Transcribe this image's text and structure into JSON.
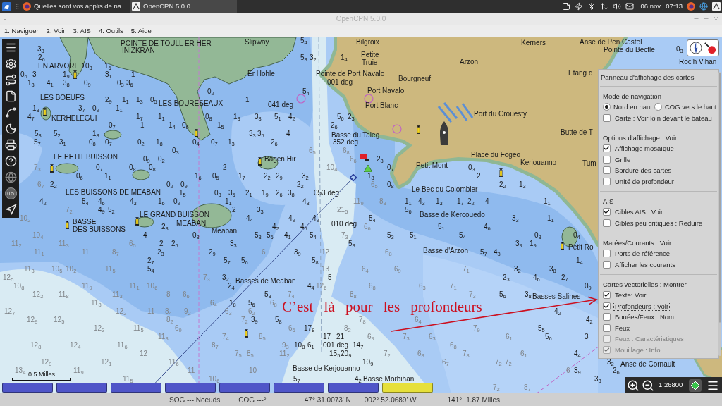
{
  "taskbar": {
    "windows": [
      {
        "title": "Quelles sont vos applis de na...",
        "selected": false
      },
      {
        "title": "OpenCPN 5.0.0",
        "selected": true
      }
    ],
    "clock": "06 nov., 07:13"
  },
  "window": {
    "title": "OpenCPN 5.0.0"
  },
  "menu": [
    "1: Naviguer",
    "2: Voir",
    "3: AIS",
    "4: Outils",
    "5: Aide"
  ],
  "toolbar": {
    "scale_button": "0.5"
  },
  "map": {
    "labels": [
      "POINTE DE TOULL ER HER",
      "INIZKRAN",
      "Slipway",
      "EN ARVORED",
      "Er Hohle",
      "LES BOEUFS",
      "KERHELEGUI",
      "LES BOURESEAUX",
      "041 deg",
      "LE PETIT BUISSON",
      "Bagen Hir",
      "LES BUISSONS DE MEABAN",
      "BASSE",
      "DES BUISSONS",
      "LE GRAND BUISSON",
      "MEABAN",
      "Meaban",
      "Basses de Meaban",
      "Bilgroix",
      "Petite",
      "Truie",
      "Pointe de Port Navalo",
      "001 deg",
      "Bourgneuf",
      "Arzon",
      "Kerners",
      "Anse de Pen Castel",
      "Pointe du Becfle",
      "Roc'h Vihan",
      "Etang d",
      "Port Navalo",
      "Port Blanc",
      "Port du Crouesty",
      "Butte de T",
      "Basse du Taleg",
      "352 deg",
      "Place du Fogeo",
      "Petit Mont",
      "Kerjouanno",
      "Tum",
      "Le Bec du Colombier",
      "053 deg",
      "Basse de Kercouedo",
      "010 deg",
      "Petit Ro",
      "Basse d'Arzon",
      "Basses Salines",
      "001 deg",
      "Basse de Kerjouanno",
      "Basse Morbihan",
      "Anse de Cornault"
    ],
    "soundings": [
      "5$_{4}$",
      "3$_{8}$",
      "0$_{3}$",
      "2$_{6}$",
      "5$_{3}$",
      "3$_{2}$",
      "1$_{4}$",
      "0$_{3}$",
      "1$_{6}$",
      "0$_{6}$",
      "3",
      "1$_{9}$",
      "3$_{1}$",
      "1",
      "1$_{3}$",
      "4$_{1}$",
      "3$_{8}$",
      "0$_{9}$",
      "0$_{3}$",
      "3$_{6}$",
      "0$_{2}$",
      "5$_{4}$",
      "2$_{9}$",
      "1$_{1}$",
      "1$_{3}$",
      "0$_{5}$",
      "1",
      "1$_{8}$",
      "3$_{7}$",
      "0$_{9}$",
      "1$_{1}$",
      "4$_{7}$",
      "1$_{7}$",
      "1$_{1}$",
      "0$_{8}$",
      "1$_{3}$",
      "3$_{8}$",
      "5$_{1}$",
      "4$_{2}$",
      "5$_{6}$",
      "2$_{3}$",
      "0$_{7}$",
      "1",
      "1$_{4}$",
      "0$_{6}$",
      "1$_{5}$",
      "2$_{6}$",
      "5$_{3}$",
      "5$_{2}$",
      "1$_{8}$",
      "3$_{3}$",
      "3$_{5}$",
      "4",
      "5$_{7}$",
      "3$_{1}$",
      "0$_{8}$",
      "0$_{7}$",
      "0$_{2}$",
      "1$_{8}$",
      "0$_{4}$",
      "0$_{7}$",
      "1$_{3}$",
      "2$_{6}$",
      "0$_{3}$",
      "0$_{9}$",
      "0$_{2}$",
      "2$_{8}$",
      "0$_{7}$",
      "0$_{8}$",
      "0$_{8}$",
      "2",
      "0$_{7}$",
      "0$_{3}$",
      "0$_{6}$",
      "1$_{1}$",
      "1$_{6}$",
      "0$_{5}$",
      "1$_{7}$",
      "2$_{2}$",
      "2$_{9}$",
      "3$_{2}$",
      "1$_{8}$",
      "2",
      "2$_{2}$",
      "0$_{2}$",
      "0$_{9}$",
      "2$_{2}$",
      "0$_{8}$",
      "2$_{2}$",
      "1$_{3}$",
      "1$_{5}$",
      "0$_{3}$",
      "3$_{5}$",
      "2$_{1}$",
      "1$_{9}$",
      "2$_{6}$",
      "3$_{8}$",
      "4$_{2}$",
      "5$_{4}$",
      "4$_{6}$",
      "4$_{3}$",
      "1$_{6}$",
      "0$_{9}$",
      "1$_{1}$",
      "4$_{8}$",
      "1$_{1}$",
      "4$_{3}$",
      "1$_{3}$",
      "1$_{7}$",
      "2$_{2}$",
      "4",
      "1$_{1}$",
      "4$_{9}$",
      "5$_{2}$",
      "2",
      "3$_{3}$",
      "5$_{6}$",
      "4$_{4}$",
      "4$_{9}$",
      "4$_{9}$",
      "5$_{4}$",
      "3$_{3}$",
      "1$_{1}$",
      "2$_{3}$",
      "4$_{2}$",
      "4$_{5}$",
      "5$_{1}$",
      "4$_{6}$",
      "4",
      "0$_{8}$",
      "5$_{3}$",
      "5$_{6}$",
      "4$_{1}$",
      "5$_{4}$",
      "5$_{3}$",
      "5$_{1}$",
      "5$_{4}$",
      "0$_{8}$",
      "0$_{4}$",
      "2",
      "2$_{5}$",
      "3$_{3}$",
      "5$_{3}$",
      "3$_{9}$",
      "1$_{9}$",
      "2$_{3}$",
      "2$_{9}$",
      "3$_{9}$",
      "5$_{7}$",
      "4$_{8}$",
      "2$_{7}$",
      "5$_{7}$",
      "5$_{6}$",
      "5$_{8}$",
      "1$_{4}$",
      "5$_{4}$",
      "3$_{2}$",
      "3$_{8}$",
      "3$_{2}$",
      "5",
      "2$_{3}$",
      "4$_{6}$",
      "2$_{7}$",
      "2$_{4}$",
      "4$_{4}$",
      "0$_{9}$",
      "5$_{8}$",
      "5$_{6}$",
      "3$_{8}$",
      "1$_{8}$",
      "5$_{6}$",
      "4$_{2}$",
      "3$_{9}$",
      "5$_{8}$",
      "4$_{2}$",
      "17$_{8}$",
      "5$_{5}$",
      "17",
      "21",
      "5$_{6}$",
      "3",
      "10$_{8}$",
      "6$_{1}$",
      "14$_{7}$",
      "15$_{5}$",
      "20$_{9}$",
      "4$_{4}$",
      "10$_{9}$",
      "3$_{2}$",
      "3$_{9}$",
      "2$_{6}$",
      "5$_{7}$",
      "4$_{2}$",
      "3$_{3}$"
    ],
    "deep_soundings": [
      "6$_{5}$",
      "6$_{8}$",
      "6$_{6}$",
      "7$_{3}$",
      "10$_{4}$",
      "6$_{7}$",
      "6$_{5}$",
      "11$_{9}$",
      "8$_{3}$",
      "7$_{2}$",
      "21$_{5}$",
      "10$_{2}$",
      "6$_{6}$",
      "10$_{4}$",
      "7$_{3}$",
      "11$_{2}$",
      "11$_{3}$",
      "6$_{5}$",
      "11$_{1}$",
      "11",
      "8$_{7}$",
      "6",
      "12",
      "6$_{8}$",
      "11$_{3}$",
      "10$_{5}$",
      "10$_{2}$",
      "11$_{5}$",
      "13",
      "6$_{4}$",
      "6$_{9}$",
      "7$_{1}$",
      "12$_{5}$",
      "7$_{3}$",
      "10$_{8}$",
      "11$_{9}$",
      "11$_{1}$",
      "10$_{6}$",
      "12$_{6}$",
      "6$_{8}$",
      "6$_{3}$",
      "7$_{1}$",
      "12$_{2}$",
      "11$_{8}$",
      "11$_{3}$",
      "8",
      "6$_{6}$",
      "7$_{4}$",
      "8$_{8}$",
      "7$_{3}$",
      "11$_{8}$",
      "6$_{4}$",
      "6$_{8}$",
      "12$_{7}$",
      "12$_{2}$",
      "11",
      "8$_{4}$",
      "9$_{2}$",
      "6$_{3}$",
      "6$_{2}$",
      "12$_{9}$",
      "12$_{5}$",
      "8$_{2}$",
      "7$_{2}$",
      "7$_{8}$",
      "6$_{4}$",
      "12$_{3}$",
      "11$_{5}$",
      "6$_{9}$",
      "6$_{6}$",
      "8$_{2}$",
      "7$_{9}$",
      "11$_{3}$",
      "7$_{4}$",
      "8$_{5}$",
      "6$_{9}$",
      "7$_{3}$",
      "6$_{3}$",
      "6$_{1}$",
      "12$_{8}$",
      "12$_{4}$",
      "11$_{6}$",
      "8$_{7}$",
      "9$_{3}$",
      "6$_{8}$",
      "12",
      "7$_{5}$",
      "8$_{5}$",
      "11$_{2}$",
      "7$_{2}$",
      "6$_{8}$",
      "7$_{8}$",
      "6$_{1}$",
      "12$_{9}$",
      "12$_{1}$",
      "11$_{6}$",
      "6$_{7}$",
      "7$_{2}$",
      "7$_{2}$",
      "13$_{4}$",
      "11$_{9}$",
      "11",
      "10",
      "6",
      "11$_{5}$",
      "10$_{6}$",
      "7$_{2}$",
      "8$_{7}$"
    ],
    "annotation": "C’est là pour les profondeurs",
    "scale_bar": "0.5 Milles"
  },
  "display_panel": {
    "title": "Panneau d'affichage des cartes",
    "sections": [
      {
        "title": "Mode de navigation",
        "items": [
          {
            "kind": "radio",
            "label": "Nord en haut",
            "selected": true,
            "disabled": false,
            "focused": false
          },
          {
            "kind": "radio",
            "label": "COG vers le haut",
            "selected": false,
            "disabled": false,
            "focused": false
          },
          {
            "kind": "checkbox",
            "label": "Carte : Voir loin devant le bateau",
            "checked": false,
            "disabled": false,
            "focused": false
          }
        ]
      },
      {
        "title": "Options d'affichage : Voir",
        "items": [
          {
            "kind": "checkbox",
            "label": "Affichage mosaïque",
            "checked": true,
            "disabled": false,
            "focused": false
          },
          {
            "kind": "checkbox",
            "label": "Grille",
            "checked": false,
            "disabled": false,
            "focused": false
          },
          {
            "kind": "checkbox",
            "label": "Bordure des cartes",
            "checked": false,
            "disabled": false,
            "focused": false
          },
          {
            "kind": "checkbox",
            "label": "Unité de profondeur",
            "checked": false,
            "disabled": false,
            "focused": false
          }
        ]
      },
      {
        "title": "AIS",
        "items": [
          {
            "kind": "checkbox",
            "label": "Cibles AIS : Voir",
            "checked": true,
            "disabled": false,
            "focused": false
          },
          {
            "kind": "checkbox",
            "label": "Cibles peu critiques : Reduire",
            "checked": false,
            "disabled": false,
            "focused": false
          }
        ]
      },
      {
        "title": "Marées/Courants : Voir",
        "items": [
          {
            "kind": "checkbox",
            "label": "Ports de référence",
            "checked": false,
            "disabled": false,
            "focused": false
          },
          {
            "kind": "checkbox",
            "label": "Afficher les courants",
            "checked": false,
            "disabled": false,
            "focused": false
          }
        ]
      },
      {
        "title": "Cartes vectorielles : Montrer",
        "items": [
          {
            "kind": "checkbox",
            "label": "Texte: Voir",
            "checked": true,
            "disabled": false,
            "focused": false
          },
          {
            "kind": "checkbox",
            "label": "Profondeurs : Voir",
            "checked": true,
            "disabled": false,
            "focused": true
          },
          {
            "kind": "checkbox",
            "label": "Bouées/Feux : Nom",
            "checked": false,
            "disabled": false,
            "focused": false
          },
          {
            "kind": "checkbox",
            "label": "Feux",
            "checked": false,
            "disabled": false,
            "focused": false
          },
          {
            "kind": "checkbox",
            "label": "Feux : Caractéristiques",
            "checked": false,
            "disabled": true,
            "focused": false
          },
          {
            "kind": "checkbox",
            "label": "Mouillage : Info",
            "checked": true,
            "disabled": true,
            "focused": false
          }
        ]
      }
    ]
  },
  "chart_keys": [
    {
      "color": "#4f55c8"
    },
    {
      "color": "#4f55c8"
    },
    {
      "color": "#4f55c8"
    },
    {
      "color": "#4f55c8"
    },
    {
      "color": "#4f55c8"
    },
    {
      "color": "#4f55c8"
    },
    {
      "color": "#4f55c8"
    },
    {
      "color": "#e6e03a"
    }
  ],
  "zoom_controls": {
    "scale": "1:26800"
  },
  "status_bar": [
    "SOG --- Noeuds",
    "COG ---°",
    "47° 31.0073' N",
    "002° 52.0689' W",
    "141°",
    "1.87 Milles"
  ]
}
